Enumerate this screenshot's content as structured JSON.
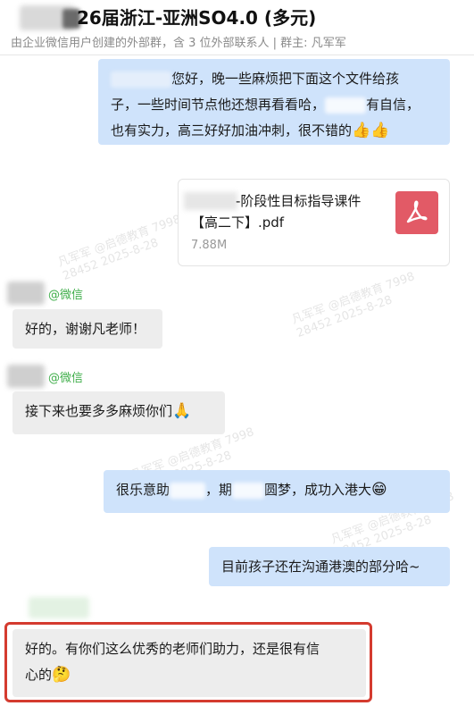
{
  "header": {
    "title": "26届浙江-亚洲SO4.0 (多元)",
    "subtitle": "由企业微信用户创建的外部群，含 3 位外部联系人 | 群主: 凡军军"
  },
  "watermark": {
    "line1": "凡军军 @启德教育 7998",
    "line2": "28452 2025-8-28"
  },
  "messages": {
    "m1": {
      "line1": "您好，晚一些麻烦把下面这个文件给孩",
      "line2": "子，一些时间节点他还想再看看哈，",
      "line2b": "有自信，",
      "line3": "也有实力，高三好好加油冲刺，很不错的",
      "emoji": "👍👍"
    },
    "file": {
      "name_line1": "-阶段性目标指导课件",
      "name_line2": "【高二下】.pdf",
      "size": "7.88M",
      "icon": "pdf-icon"
    },
    "sender_tag": "@微信",
    "m2": {
      "text": "好的，谢谢凡老师！"
    },
    "m3": {
      "text": "接下来也要多多麻烦你们",
      "emoji": "🙏"
    },
    "m4": {
      "part1": "很乐意助",
      "part2": "，期",
      "part3": "圆梦，成功入港大",
      "emoji": "😁"
    },
    "m5": {
      "text": "目前孩子还在沟通港澳的部分哈~"
    },
    "m6": {
      "line1": "好的。有你们这么优秀的老师们助力，还是很有信",
      "line2": "心的",
      "emoji": "🤔"
    }
  },
  "colors": {
    "out_bubble": "#cfe3fb",
    "in_bubble": "#ededed",
    "sender_green": "#3fae4a",
    "highlight_red": "#d43b2f",
    "pdf_red": "#e25a66"
  }
}
